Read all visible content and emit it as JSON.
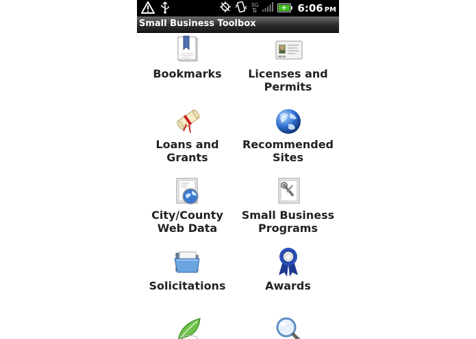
{
  "status_bar": {
    "time": "6:06",
    "ampm": "PM",
    "network": "3G",
    "icons": [
      "warning-icon",
      "usb-icon",
      "gps-icon",
      "vibrate-icon",
      "network-3g-icon",
      "signal-icon",
      "battery-icon"
    ],
    "battery_color": "#3fbf1f"
  },
  "title_bar": {
    "title": "Small Business Toolbox"
  },
  "menu": {
    "items": [
      {
        "label": "Bookmarks",
        "icon": "bookmark-icon"
      },
      {
        "label": "Licenses and\nPermits",
        "icon": "id-card-icon"
      },
      {
        "label": "Loans and\nGrants",
        "icon": "scroll-icon"
      },
      {
        "label": "Recommended\nSites",
        "icon": "globe-icon"
      },
      {
        "label": "City/County\nWeb Data",
        "icon": "web-document-icon"
      },
      {
        "label": "Small Business\nPrograms",
        "icon": "tools-document-icon"
      },
      {
        "label": "Solicitations",
        "icon": "folder-icon"
      },
      {
        "label": "Awards",
        "icon": "ribbon-icon"
      },
      {
        "label": "",
        "icon": "leaf-icon"
      },
      {
        "label": "",
        "icon": "magnifier-icon"
      }
    ]
  }
}
